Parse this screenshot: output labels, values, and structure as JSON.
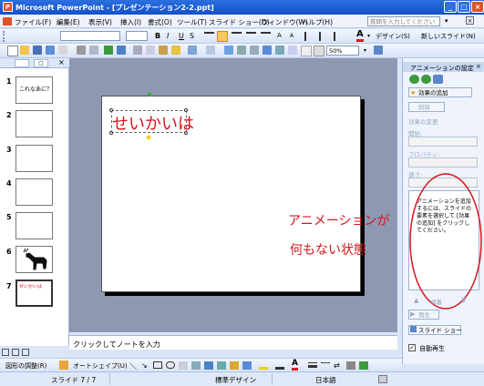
{
  "window": {
    "title": "Microsoft PowerPoint - [プレゼンテーション2-2.ppt]",
    "icon": "powerpoint-icon"
  },
  "menubar": {
    "items": [
      "ファイル(F)",
      "編集(E)",
      "表示(V)",
      "挿入(I)",
      "書式(O)",
      "ツール(T)",
      "スライド ショー(D)",
      "ウィンドウ(W)",
      "ヘルプ(H)"
    ],
    "question_placeholder": "質問を入力してください"
  },
  "formatting_toolbar": {
    "bold": "B",
    "italic": "I",
    "underline": "U",
    "shadow": "S",
    "design_label": "デザイン(S)",
    "new_slide_label": "新しいスライド(N)"
  },
  "standard_toolbar": {
    "zoom": "50%"
  },
  "outline": {
    "tab_slides": "▢",
    "slides": [
      {
        "num": "1",
        "title": "これなあに？"
      },
      {
        "num": "2",
        "title": ""
      },
      {
        "num": "3",
        "title": ""
      },
      {
        "num": "4",
        "title": ""
      },
      {
        "num": "5",
        "title": ""
      },
      {
        "num": "6",
        "title": ""
      },
      {
        "num": "7",
        "title": "せいかいは"
      }
    ]
  },
  "slide": {
    "text": "せいかいは"
  },
  "annotation": {
    "line1": "アニメーションが",
    "line2": "何もない状態"
  },
  "notes": {
    "placeholder": "クリックしてノートを入力"
  },
  "taskpane": {
    "title": "アニメーションの設定",
    "add_effect": "効果の追加",
    "remove": "削除",
    "modify_effect": "効果の変更",
    "start": "開始:",
    "property": "プロパティ:",
    "speed": "速さ:",
    "hint": "アニメーションを追加するには、スライドの要素を選択して [効果の追加] をクリックしてください。",
    "reorder": "順番",
    "play": "再生",
    "slideshow": "スライド ショー",
    "autoplay": "自動再生"
  },
  "drawbar": {
    "draw_label": "図形の調整(R)",
    "autoshape_label": "オートシェイプ(U)"
  },
  "status": {
    "slide": "スライド 7 / 7",
    "design": "標準デザイン",
    "language": "日本語"
  }
}
